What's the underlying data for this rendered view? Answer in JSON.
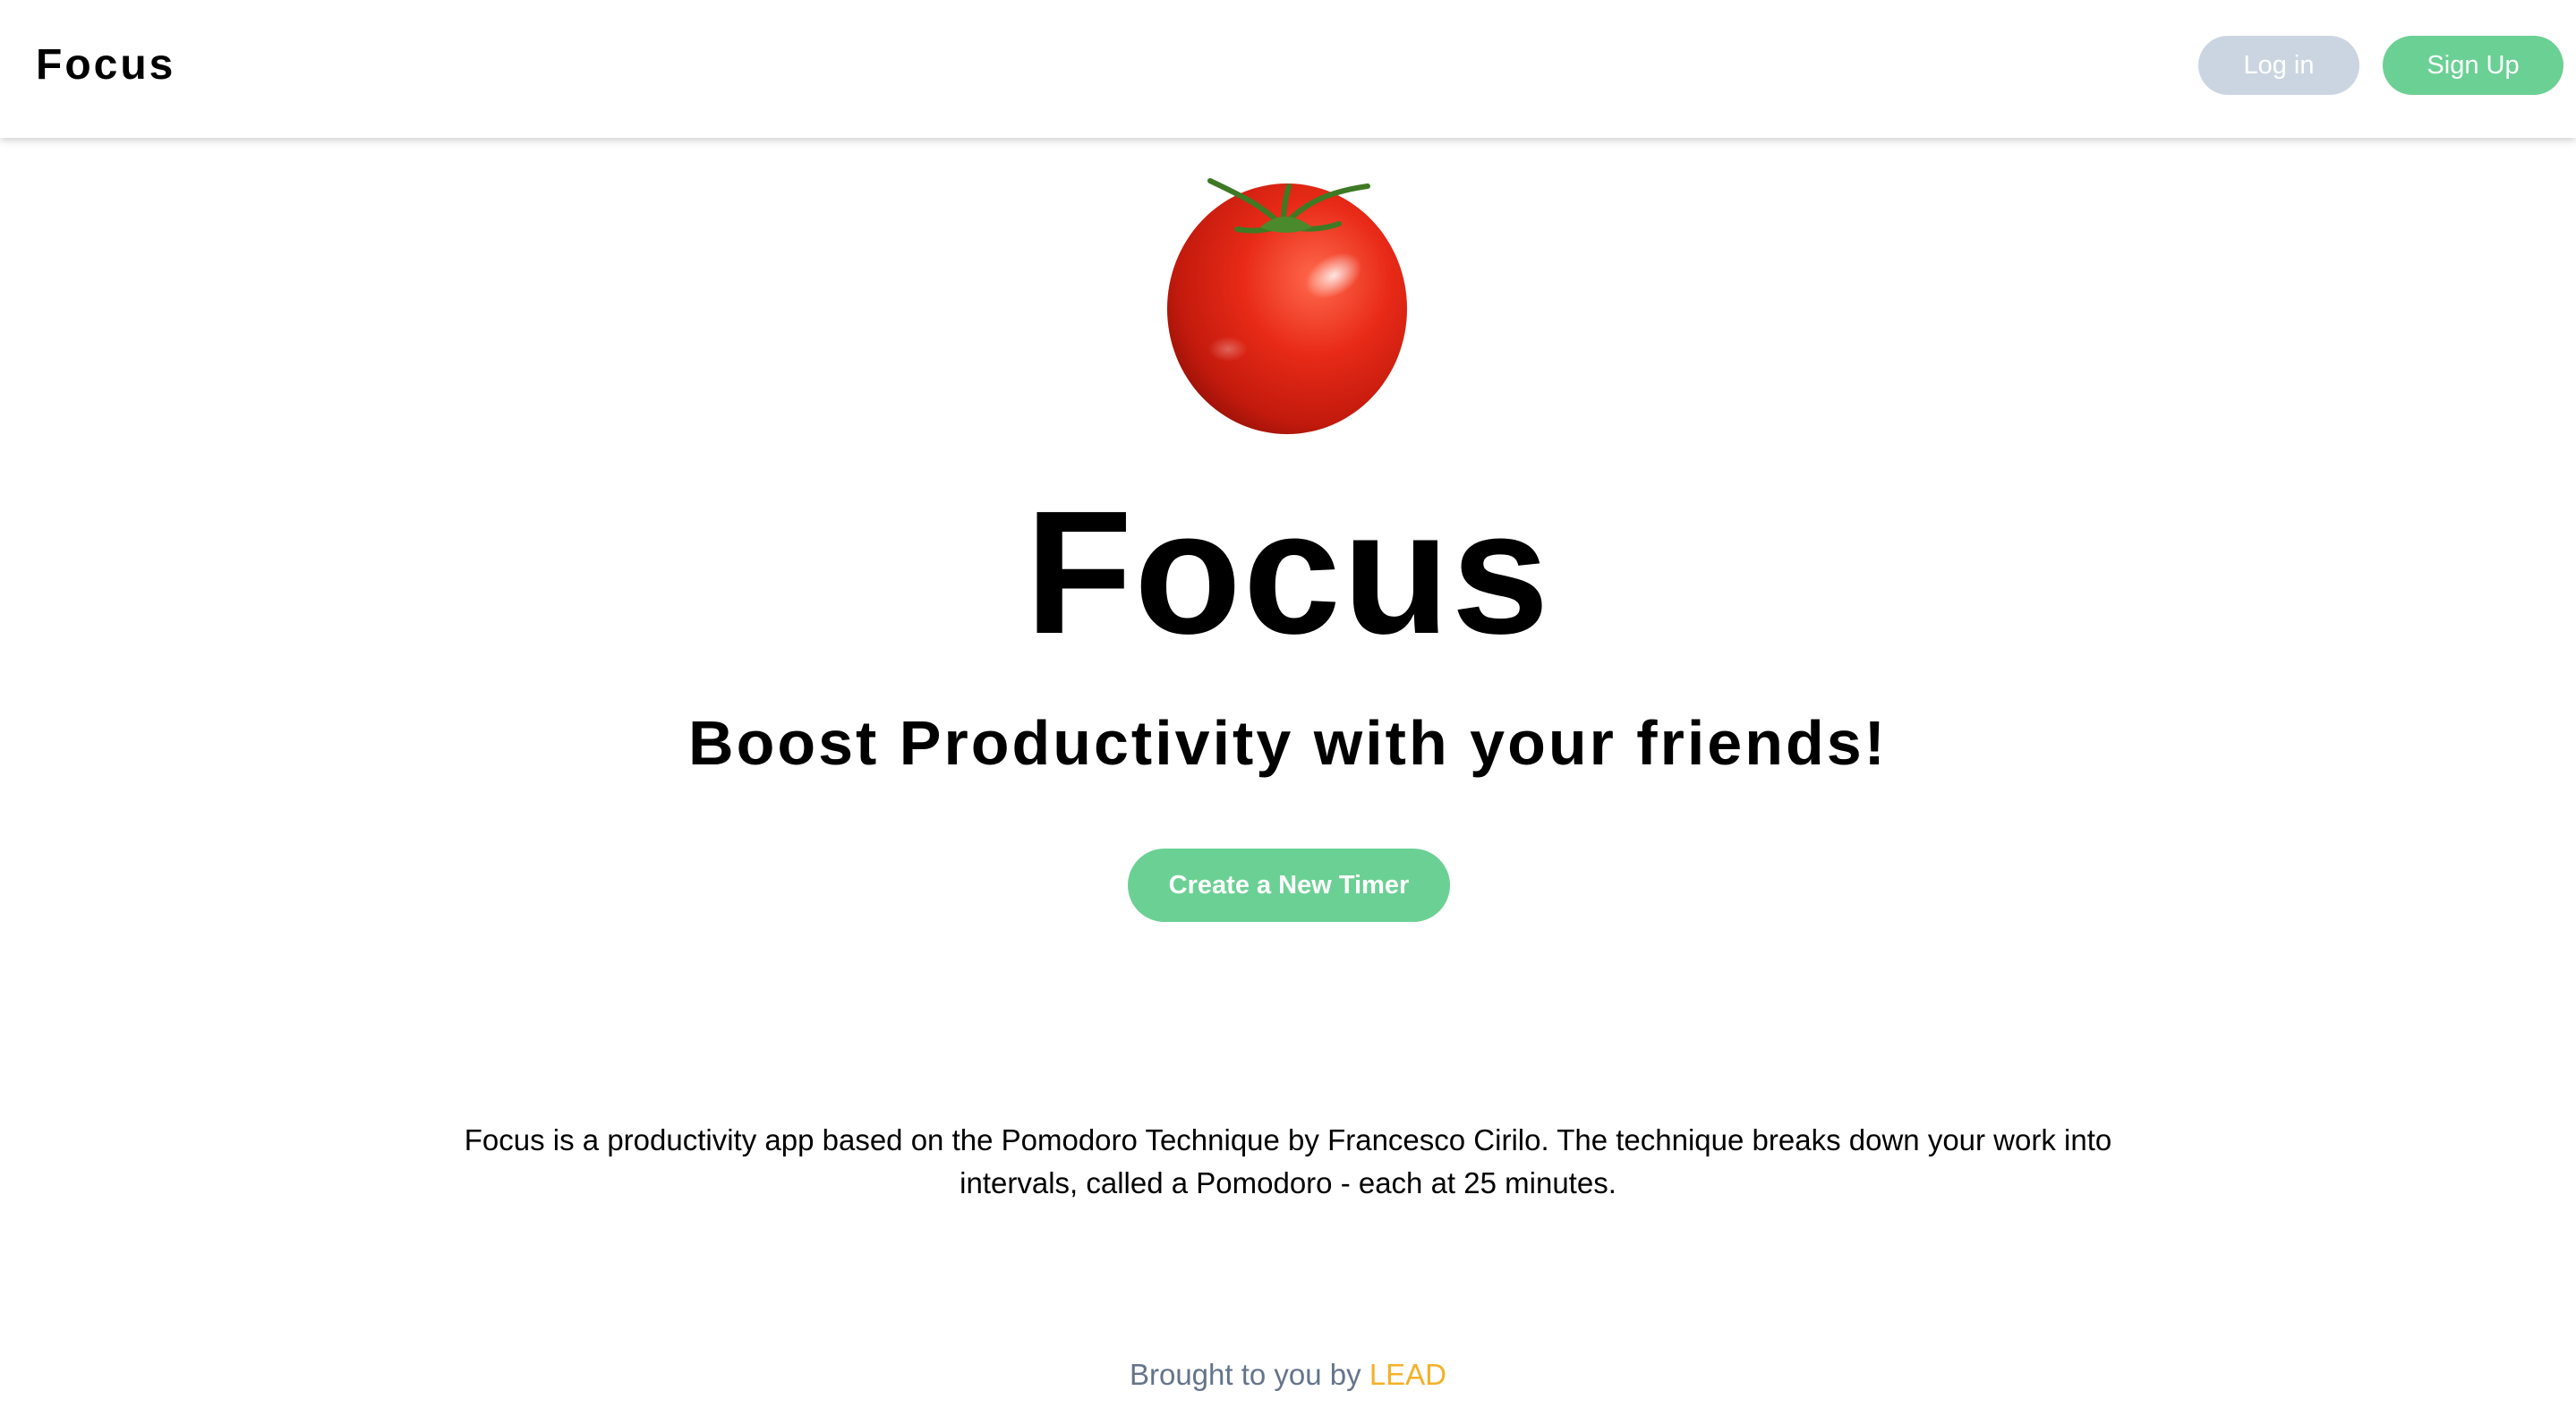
{
  "navbar": {
    "brand": "Focus",
    "login_label": "Log in",
    "signup_label": "Sign Up"
  },
  "hero": {
    "image_icon": "tomato-icon",
    "title": "Focus",
    "subtitle": "Boost Productivity with your friends!",
    "cta_label": "Create a New Timer"
  },
  "description": "Focus is a productivity app based on the Pomodoro Technique by Francesco Cirilo. The technique breaks down your work into intervals, called a Pomodoro - each at 25 minutes.",
  "footer": {
    "prefix": "Brought to you by ",
    "link_label": "LEAD"
  },
  "colors": {
    "accent_green": "#6bd094",
    "login_gray": "#cbd5e1",
    "footer_gray": "#64748b",
    "link_orange": "#f5b027"
  }
}
